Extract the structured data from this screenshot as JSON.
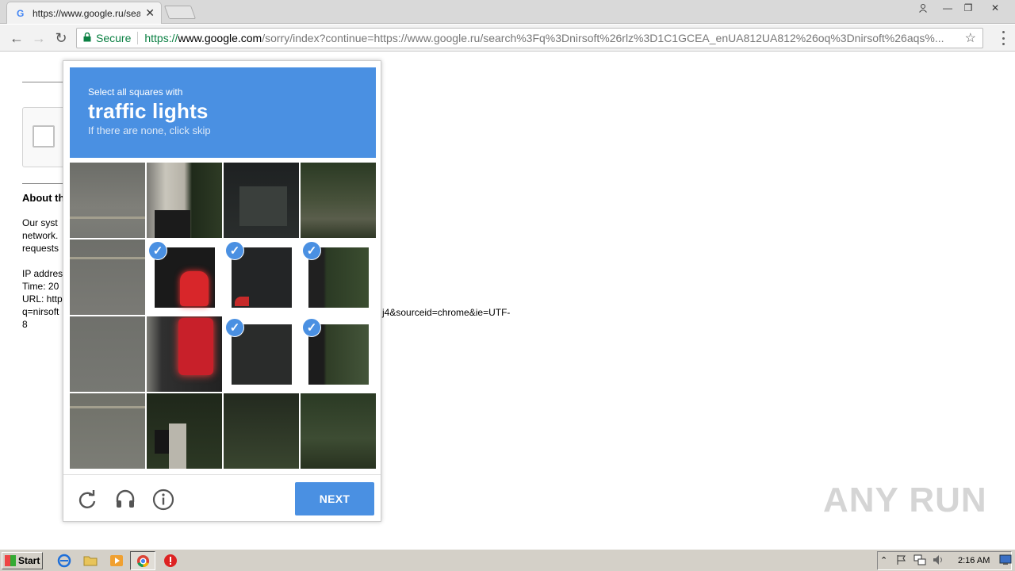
{
  "browser": {
    "tab_title": "https://www.google.ru/search?q=nirsoft",
    "security_label": "Secure",
    "url_scheme": "https://",
    "url_host": "www.google.com",
    "url_rest": "/sorry/index?continue=https://www.google.ru/search%3Fq%3Dnirsoft%26rlz%3D1C1GCEA_enUA812UA812%26oq%3Dnirsoft%26aqs%..."
  },
  "background_page": {
    "about_heading": "About th",
    "para_lines": [
      "Our syst",
      "network.",
      "requests"
    ],
    "ip_lines": [
      "IP addres",
      "Time: 20",
      "URL: http",
      "q=nirsoft",
      "8"
    ],
    "url_tail": "j4&sourceid=chrome&ie=UTF-"
  },
  "captcha": {
    "instruction": "Select all squares with",
    "target": "traffic lights",
    "hint": "If there are none, click skip",
    "next_label": "NEXT",
    "tiles": [
      {
        "row": 1,
        "col": 1,
        "selected": false
      },
      {
        "row": 1,
        "col": 2,
        "selected": false
      },
      {
        "row": 1,
        "col": 3,
        "selected": false
      },
      {
        "row": 1,
        "col": 4,
        "selected": false
      },
      {
        "row": 2,
        "col": 1,
        "selected": false
      },
      {
        "row": 2,
        "col": 2,
        "selected": true
      },
      {
        "row": 2,
        "col": 3,
        "selected": true
      },
      {
        "row": 2,
        "col": 4,
        "selected": true
      },
      {
        "row": 3,
        "col": 1,
        "selected": false
      },
      {
        "row": 3,
        "col": 2,
        "selected": false
      },
      {
        "row": 3,
        "col": 3,
        "selected": true
      },
      {
        "row": 3,
        "col": 4,
        "selected": true
      },
      {
        "row": 4,
        "col": 1,
        "selected": false
      },
      {
        "row": 4,
        "col": 2,
        "selected": false
      },
      {
        "row": 4,
        "col": 3,
        "selected": false
      },
      {
        "row": 4,
        "col": 4,
        "selected": false
      }
    ],
    "footer_icons": [
      "reload-icon",
      "audio-icon",
      "info-icon"
    ]
  },
  "watermark": "ANY RUN",
  "taskbar": {
    "start_label": "Start",
    "clock": "2:16 AM"
  },
  "colors": {
    "accent": "#4a90e2",
    "secure_green": "#0b8043"
  }
}
